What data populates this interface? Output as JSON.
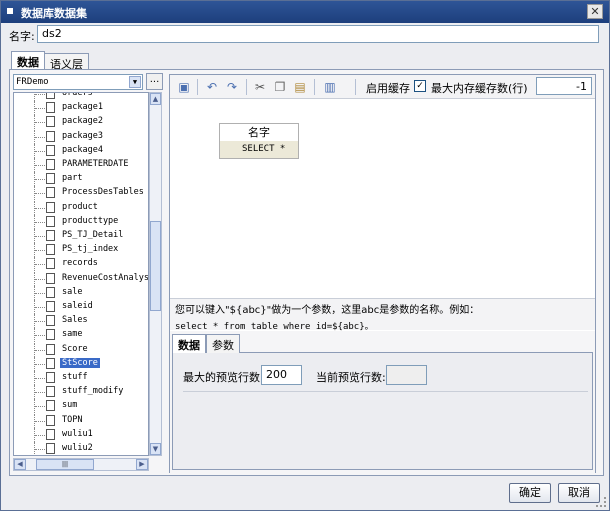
{
  "window": {
    "title": "数据库数据集"
  },
  "name_field": {
    "label": "名字:",
    "value": "ds2"
  },
  "tabs": [
    {
      "label": "数据"
    },
    {
      "label": "语义层"
    }
  ],
  "datasource": {
    "selected": "FRDemo",
    "more_label": "..."
  },
  "tree_items": [
    {
      "label": "orders"
    },
    {
      "label": "package1"
    },
    {
      "label": "package2"
    },
    {
      "label": "package3"
    },
    {
      "label": "package4"
    },
    {
      "label": "PARAMETERDATE"
    },
    {
      "label": "part"
    },
    {
      "label": "ProcessDesTables"
    },
    {
      "label": "product"
    },
    {
      "label": "producttype"
    },
    {
      "label": "PS_TJ_Detail"
    },
    {
      "label": "PS_tj_index"
    },
    {
      "label": "records"
    },
    {
      "label": "RevenueCostAnalys:"
    },
    {
      "label": "sale"
    },
    {
      "label": "saleid"
    },
    {
      "label": "Sales"
    },
    {
      "label": "same"
    },
    {
      "label": "Score"
    },
    {
      "label": "StScore"
    },
    {
      "label": "stuff"
    },
    {
      "label": "stuff_modify"
    },
    {
      "label": "sum"
    },
    {
      "label": "TOPN"
    },
    {
      "label": "wuliu1"
    },
    {
      "label": "wuliu2"
    }
  ],
  "selected_tree_item": "StScore",
  "toolbar": {
    "cache_label": "启用缓存",
    "cache_checked": true,
    "max_cache_label": "最大内存缓存数(行)",
    "max_cache_value": "-1",
    "icons": [
      "preview-icon",
      "undo-icon",
      "redo-icon",
      "cut-icon",
      "copy-icon",
      "paste-icon",
      "columns-icon"
    ]
  },
  "sql_popup": {
    "header": "名字",
    "row": "SELECT *"
  },
  "hint": {
    "line1": "您可以键入\"${abc}\"做为一个参数，这里abc是参数的名称。例如：",
    "line2": "select * from table where id=${abc}。"
  },
  "bottom_tabs": [
    {
      "label": "数据"
    },
    {
      "label": "参数"
    }
  ],
  "preview": {
    "max_rows_label": "最大的预览行数:",
    "max_rows_value": "200",
    "current_rows_label": "当前预览行数:",
    "current_rows_value": ""
  },
  "buttons": {
    "ok": "确定",
    "cancel": "取消"
  }
}
